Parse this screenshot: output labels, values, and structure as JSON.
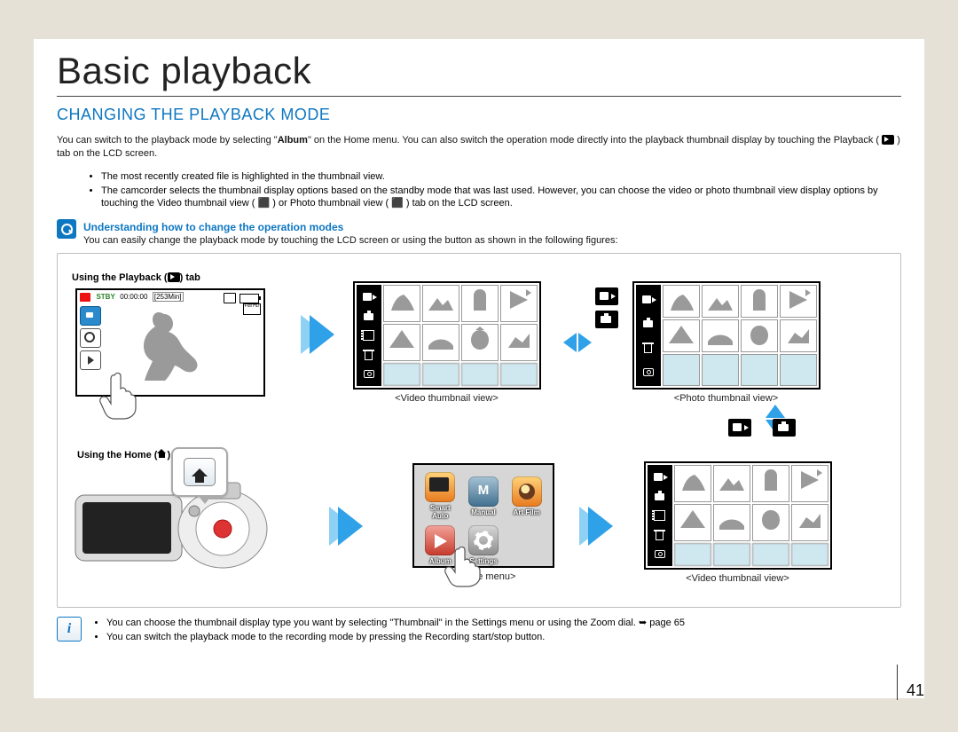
{
  "page": {
    "title": "Basic playback",
    "section_heading": "CHANGING THE PLAYBACK MODE",
    "number": "41"
  },
  "intro": {
    "line1_pre": "You can switch to the playback mode by selecting \"",
    "line1_bold": "Album",
    "line1_post": "\" on the Home menu. You can also switch the operation mode directly into the playback thumbnail display by touching the Playback (",
    "line1_tail": ") tab on the LCD screen.",
    "bullets": [
      "The most recently created file is highlighted in the thumbnail view.",
      "The camcorder selects the thumbnail display options based on the standby mode that was last used. However, you can choose the video or photo thumbnail view display options by touching the Video thumbnail view ( ⬛ ) or Photo thumbnail view ( ⬛ ) tab on the LCD screen."
    ]
  },
  "callout": {
    "title": "Understanding how to change the operation modes",
    "body": "You can easily change the playback mode by touching the LCD screen or using the button as shown in the following figures:"
  },
  "figure": {
    "caption_playback_tab_pre": "Using the Playback (",
    "caption_playback_tab_post": ") tab",
    "caption_home_button_pre": "Using the Home (",
    "caption_home_button_post": ") button",
    "video_thumb_label": "<Video thumbnail view>",
    "photo_thumb_label": "<Photo thumbnail view>",
    "home_menu_label": "<Home menu>",
    "video_thumb_label2": "<Video thumbnail view>",
    "rec_status": {
      "stby": "STBY",
      "time": "00:00:00",
      "remaining": "[253Min]",
      "fullhd": "Full HD"
    },
    "home_menu_items": [
      "Smart Auto",
      "Manual",
      "Art Film",
      "Album",
      "Settings"
    ]
  },
  "footer": {
    "bullets_pre1": "You can choose the thumbnail display type you want by selecting \"",
    "bullets_bold1": "Thumbnail",
    "bullets_mid1": "\" in the Settings menu or using the ",
    "bullets_bold1b": "Zoom dial",
    "bullets_post1": ". ",
    "page_ref": "page 65",
    "bullets_pre2": "You can switch the playback mode to the recording mode by pressing the ",
    "bullets_bold2": "Recording start/stop",
    "bullets_post2": " button."
  }
}
